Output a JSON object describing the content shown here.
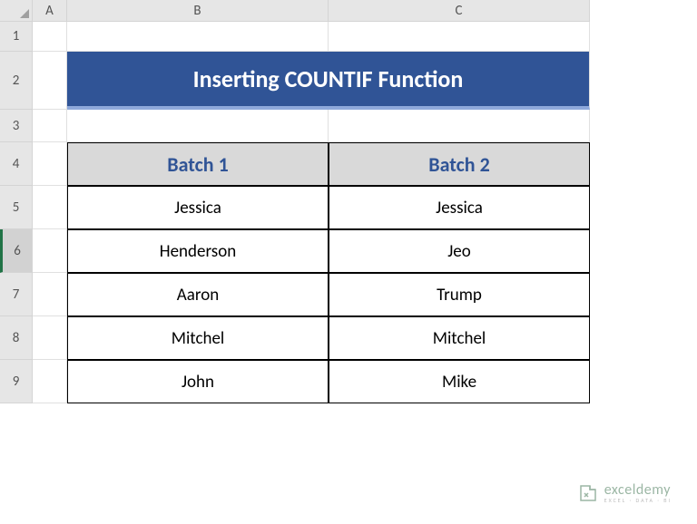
{
  "columns": [
    "A",
    "B",
    "C"
  ],
  "rows": [
    "1",
    "2",
    "3",
    "4",
    "5",
    "6",
    "7",
    "8",
    "9"
  ],
  "active_row": "6",
  "title": "Inserting COUNTIF Function",
  "table": {
    "headers": [
      "Batch 1",
      "Batch 2"
    ],
    "data": [
      [
        "Jessica",
        "Jessica"
      ],
      [
        "Henderson",
        "Jeo"
      ],
      [
        "Aaron",
        "Trump"
      ],
      [
        "Mitchel",
        "Mitchel"
      ],
      [
        "John",
        "Mike"
      ]
    ]
  },
  "watermark": {
    "main": "exceldemy",
    "sub": "EXCEL · DATA · BI"
  },
  "chart_data": {
    "type": "table",
    "title": "Inserting COUNTIF Function",
    "columns": [
      "Batch 1",
      "Batch 2"
    ],
    "rows": [
      {
        "Batch 1": "Jessica",
        "Batch 2": "Jessica"
      },
      {
        "Batch 1": "Henderson",
        "Batch 2": "Jeo"
      },
      {
        "Batch 1": "Aaron",
        "Batch 2": "Trump"
      },
      {
        "Batch 1": "Mitchel",
        "Batch 2": "Mitchel"
      },
      {
        "Batch 1": "John",
        "Batch 2": "Mike"
      }
    ]
  }
}
